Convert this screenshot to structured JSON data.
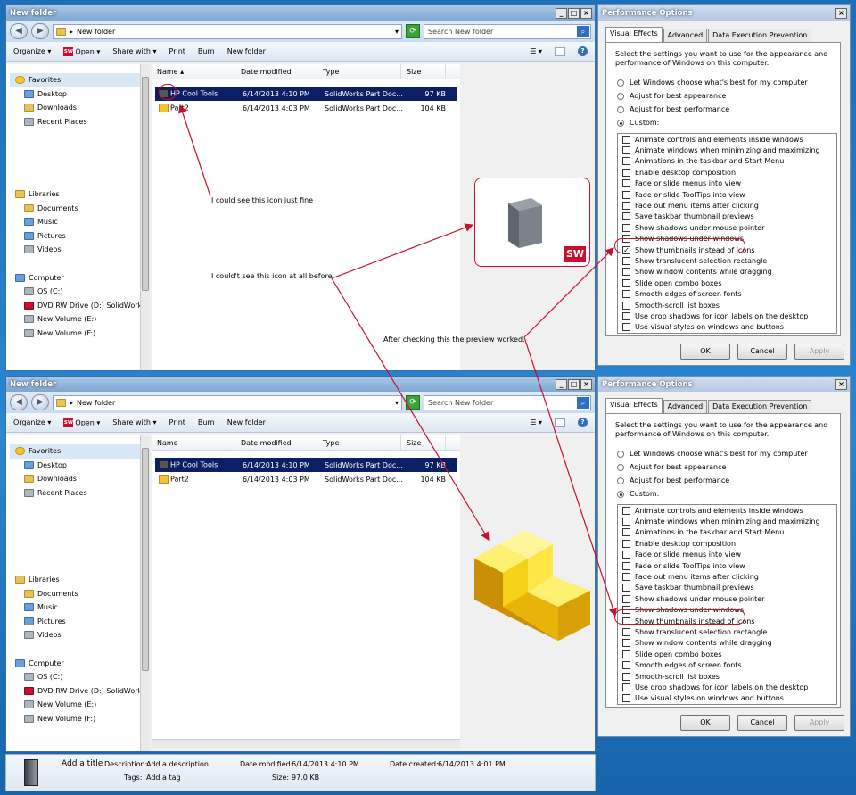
{
  "explorer": {
    "title": "New folder",
    "path": "New folder",
    "search_placeholder": "Search New folder",
    "toolbar": {
      "organize": "Organize",
      "open": "Open",
      "share": "Share with",
      "print": "Print",
      "burn": "Burn",
      "new_folder": "New folder"
    },
    "nav": {
      "favorites": "Favorites",
      "desktop": "Desktop",
      "downloads": "Downloads",
      "recent": "Recent Places",
      "libraries": "Libraries",
      "documents": "Documents",
      "music": "Music",
      "pictures": "Pictures",
      "videos": "Videos",
      "computer": "Computer",
      "os": "OS (C:)",
      "dvd": "DVD RW Drive (D:) SolidWork",
      "vol_e": "New Volume (E:)",
      "vol_f": "New Volume (F:)"
    },
    "columns": {
      "name": "Name",
      "date": "Date modified",
      "type": "Type",
      "size": "Size"
    },
    "files": [
      {
        "name": "HP Cool Tools",
        "date": "6/14/2013 4:10 PM",
        "type": "SolidWorks Part Doc...",
        "size": "97 KB"
      },
      {
        "name": "Part2",
        "date": "6/14/2013 4:03 PM",
        "type": "SolidWorks Part Doc...",
        "size": "104 KB"
      }
    ]
  },
  "details": {
    "title": "Add a title",
    "desc_label": "Description:",
    "desc_value": "Add a description",
    "tags_label": "Tags:",
    "tags_value": "Add a tag",
    "modified_label": "Date modified:",
    "modified_value": "6/14/2013 4:10 PM",
    "size_label": "Size:",
    "size_value": "97.0 KB",
    "created_label": "Date created:",
    "created_value": "6/14/2013 4:01 PM"
  },
  "perf": {
    "title": "Performance Options",
    "tabs": {
      "visual": "Visual Effects",
      "advanced": "Advanced",
      "dep": "Data Execution Prevention"
    },
    "desc": "Select the settings you want to use for the appearance and performance of Windows on this computer.",
    "radios": {
      "best_choice": "Let Windows choose what's best for my computer",
      "appearance": "Adjust for best appearance",
      "performance": "Adjust for best performance",
      "custom": "Custom:"
    },
    "options": [
      "Animate controls and elements inside windows",
      "Animate windows when minimizing and maximizing",
      "Animations in the taskbar and Start Menu",
      "Enable desktop composition",
      "Fade or slide menus into view",
      "Fade or slide ToolTips into view",
      "Fade out menu items after clicking",
      "Save taskbar thumbnail previews",
      "Show shadows under mouse pointer",
      "Show shadows under windows",
      "Show thumbnails instead of icons",
      "Show translucent selection rectangle",
      "Show window contents while dragging",
      "Slide open combo boxes",
      "Smooth edges of screen fonts",
      "Smooth-scroll list boxes",
      "Use drop shadows for icon labels on the desktop",
      "Use visual styles on windows and buttons"
    ],
    "buttons": {
      "ok": "OK",
      "cancel": "Cancel",
      "apply": "Apply"
    }
  },
  "annotations": {
    "see_fine": "I could see this icon just fine",
    "not_see": "I could't see this icon at all before",
    "after": "After checking this the preview worked."
  },
  "badge": {
    "sw": "SW"
  },
  "colors": {
    "annotation": "#c8102e",
    "selection": "#0b1f66",
    "desktop": "#1c6fb8"
  }
}
